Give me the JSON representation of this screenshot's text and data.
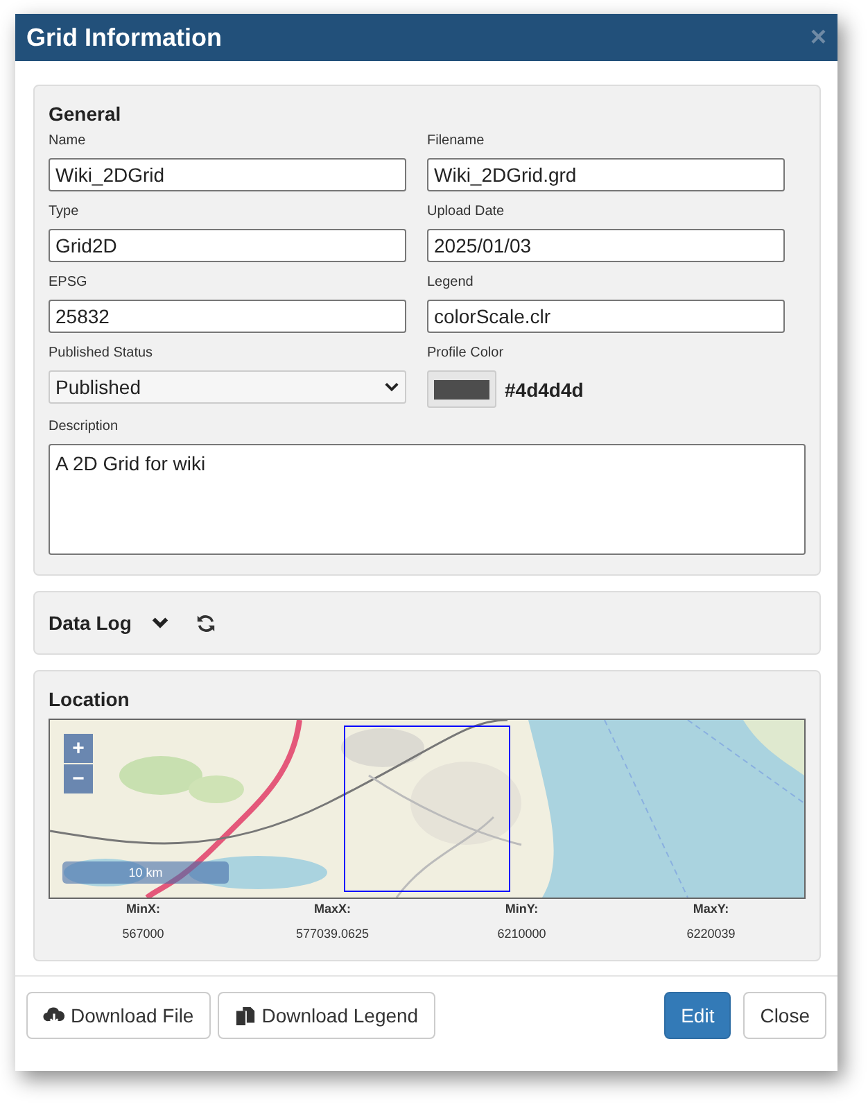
{
  "window": {
    "title": "Grid Information",
    "close": "×"
  },
  "general": {
    "title": "General",
    "fields": [
      {
        "label": "Name",
        "value": "Wiki_2DGrid",
        "kind": "text"
      },
      {
        "label": "Filename",
        "value": "Wiki_2DGrid.grd",
        "kind": "text"
      },
      {
        "label": "Type",
        "value": "Grid2D",
        "kind": "text"
      },
      {
        "label": "Upload Date",
        "value": "2025/01/03",
        "kind": "text"
      },
      {
        "label": "EPSG",
        "value": "25832",
        "kind": "text"
      },
      {
        "label": "Legend",
        "value": "colorScale.clr",
        "kind": "text"
      },
      {
        "label": "Published Status",
        "value": "Published",
        "kind": "select"
      },
      {
        "label": "Profile Color",
        "value": "#4d4d4d",
        "kind": "color"
      }
    ],
    "description": {
      "label": "Description",
      "value": "A 2D Grid for wiki"
    }
  },
  "data_log": {
    "title": "Data Log",
    "expanded": false
  },
  "location": {
    "title": "Location",
    "zoom_in": "+",
    "zoom_out": "−",
    "scale": "10 km",
    "bounds": [
      {
        "label": "MinX:",
        "value": "567000"
      },
      {
        "label": "MaxX:",
        "value": "577039.0625"
      },
      {
        "label": "MinY:",
        "value": "6210000"
      },
      {
        "label": "MaxY:",
        "value": "6220039"
      }
    ]
  },
  "footer": {
    "buttons": [
      {
        "label": "Download File",
        "kind": "download"
      },
      {
        "label": "Download Legend",
        "kind": "legend"
      },
      {
        "label": "Edit",
        "kind": "primary"
      },
      {
        "label": "Close",
        "kind": "default"
      }
    ]
  }
}
